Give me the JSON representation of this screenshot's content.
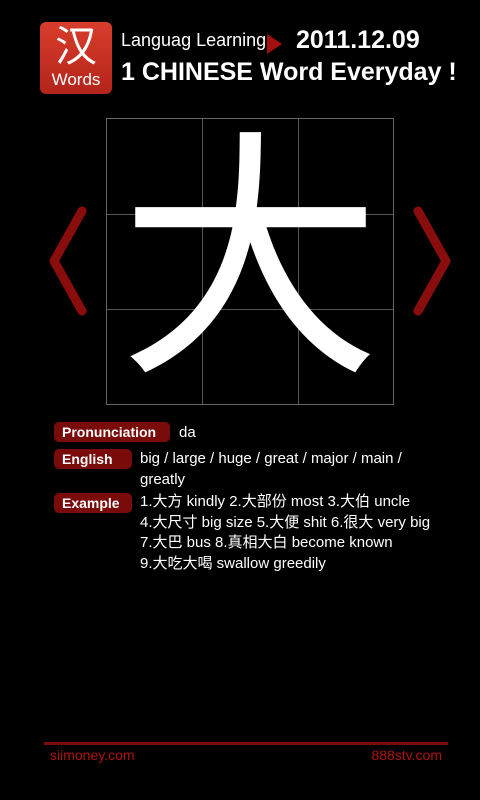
{
  "header": {
    "logo_char": "汉",
    "logo_text": "Words",
    "subtitle": "Languag Learning",
    "date": "2011.12.09",
    "headline": "1 CHINESE Word Everyday !"
  },
  "word": {
    "character": "大"
  },
  "details": {
    "pronunciation_label": "Pronunciation",
    "pronunciation": "da",
    "english_label": "English",
    "english": "big / large / huge / great / major /  main / greatly",
    "example_label": "Example",
    "examples": [
      "1.大方 kindly  2.大部份 most   3.大伯 uncle",
      "4.大尺寸 big size   5.大便 shit  6.很大 very big",
      "7.大巴 bus   8.真相大白 become known",
      "9.大吃大喝 swallow greedily"
    ]
  },
  "footer": {
    "left_link": "siimoney.com",
    "right_link": "888stv.com"
  },
  "colors": {
    "accent": "#7a0b0b",
    "logo": "#c4301f",
    "link": "#b01212"
  },
  "icons": {
    "prev": "chevron-left-icon",
    "next": "chevron-right-icon",
    "date_marker": "triangle-right-icon"
  }
}
